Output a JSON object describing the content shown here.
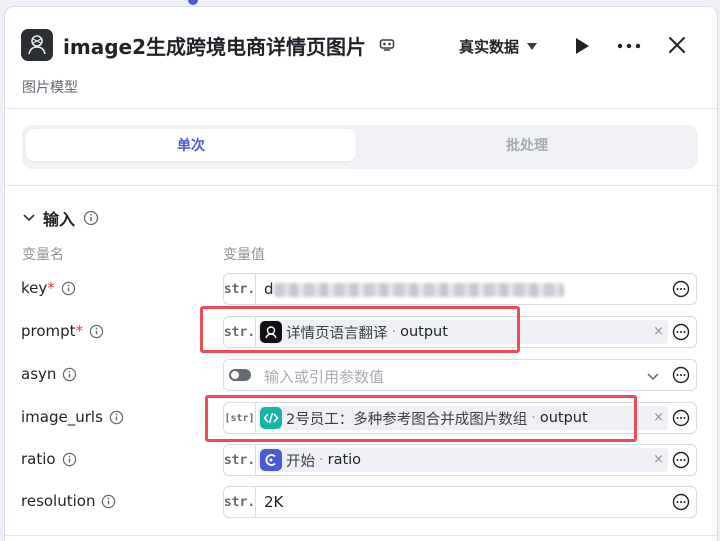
{
  "header": {
    "title": "image2生成跨境电商详情页图片",
    "subtitle": "图片模型",
    "mode": "真实数据"
  },
  "tabs": [
    {
      "label": "单次",
      "active": true
    },
    {
      "label": "批处理",
      "active": false
    }
  ],
  "section": {
    "title": "输入",
    "col_name": "变量名",
    "col_value": "变量值"
  },
  "rows": {
    "key": {
      "name": "key",
      "required": "*",
      "type": "str.",
      "value": "d"
    },
    "prompt": {
      "name": "prompt",
      "required": "*",
      "type": "str.",
      "ref_node": "详情页语言翻译",
      "sep": "·",
      "ref_field": "output"
    },
    "asyn": {
      "name": "asyn",
      "placeholder": "输入或引用参数值"
    },
    "image_urls": {
      "name": "image_urls",
      "type": "[str]",
      "ref_node": "2号员工：多种参考图合并成图片数组",
      "sep": "·",
      "ref_field": "output"
    },
    "ratio": {
      "name": "ratio",
      "type": "str.",
      "ref_node": "开始",
      "sep": "·",
      "ref_field": "ratio"
    },
    "resolution": {
      "name": "resolution",
      "type": "str.",
      "value": "2K"
    }
  },
  "clear_glyph": "×",
  "colors": {
    "accent": "#4b5bd6",
    "highlight_box": "#ee4b55",
    "code_node": "#17b4a8",
    "start_node": "#4b5bd6",
    "agent_node": "#111111"
  }
}
